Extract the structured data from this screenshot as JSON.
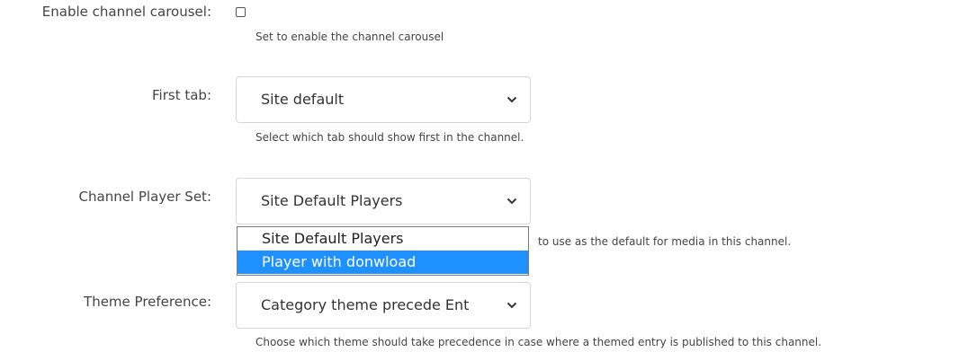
{
  "carousel": {
    "label": "Enable channel carousel:",
    "checked": false,
    "help": "Set to enable the channel carousel"
  },
  "first_tab": {
    "label": "First tab:",
    "value": "Site default",
    "help": "Select which tab should show first in the channel."
  },
  "player_set": {
    "label": "Channel Player Set:",
    "value": "Site Default Players",
    "help_visible": "to use as the default for media in this channel.",
    "options": [
      "Site Default Players",
      "Player with donwload"
    ],
    "highlighted_option": "Player with donwload"
  },
  "theme": {
    "label": "Theme Preference:",
    "value": "Category theme precede Ent",
    "help": "Choose which theme should take precedence in case where a themed entry is published to this channel."
  },
  "icons": {
    "select_arrow": "chevron-down-icon"
  },
  "colors": {
    "highlight": "#1e90ff",
    "text": "#333333",
    "border": "#d6d6d6"
  }
}
